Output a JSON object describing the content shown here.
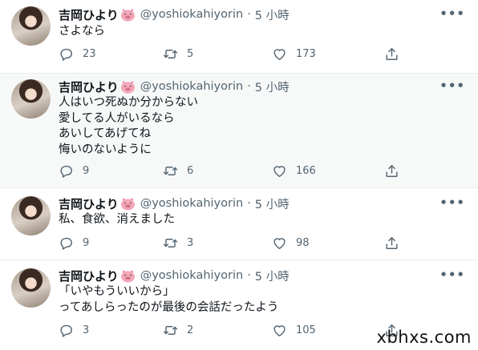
{
  "tweets": [
    {
      "name": "吉岡ひより",
      "handle": "@yoshiokahiyorin",
      "dot": "·",
      "time": "5 小時",
      "more": "•••",
      "lines": [
        "さよなら"
      ],
      "replies": "23",
      "retweets": "5",
      "likes": "173"
    },
    {
      "name": "吉岡ひより",
      "handle": "@yoshiokahiyorin",
      "dot": "·",
      "time": "5 小時",
      "more": "•••",
      "lines": [
        "人はいつ死ぬか分からない",
        "愛してる人がいるなら",
        "あいしてあげてね",
        "悔いのないように"
      ],
      "replies": "9",
      "retweets": "6",
      "likes": "166"
    },
    {
      "name": "吉岡ひより",
      "handle": "@yoshiokahiyorin",
      "dot": "·",
      "time": "5 小時",
      "more": "•••",
      "lines": [
        "私、食欲、消えました"
      ],
      "replies": "9",
      "retweets": "3",
      "likes": "98"
    },
    {
      "name": "吉岡ひより",
      "handle": "@yoshiokahiyorin",
      "dot": "·",
      "time": "5 小時",
      "more": "•••",
      "lines": [
        "「いやもういいから」",
        "ってあしらったのが最後の会話だったよう"
      ],
      "replies": "3",
      "retweets": "2",
      "likes": "105"
    }
  ],
  "watermark": "xbhxs.com",
  "icons": {
    "badge": "pig-emoji-icon",
    "reply": "reply-icon",
    "retweet": "retweet-icon",
    "like": "heart-icon",
    "share": "share-icon",
    "more": "more-icon"
  },
  "colors": {
    "muted": "#536471",
    "text": "#0f1419",
    "highlight_bg": "#f7f9f9",
    "divider": "#e6ecf0",
    "pig": "#f4a7b9"
  }
}
